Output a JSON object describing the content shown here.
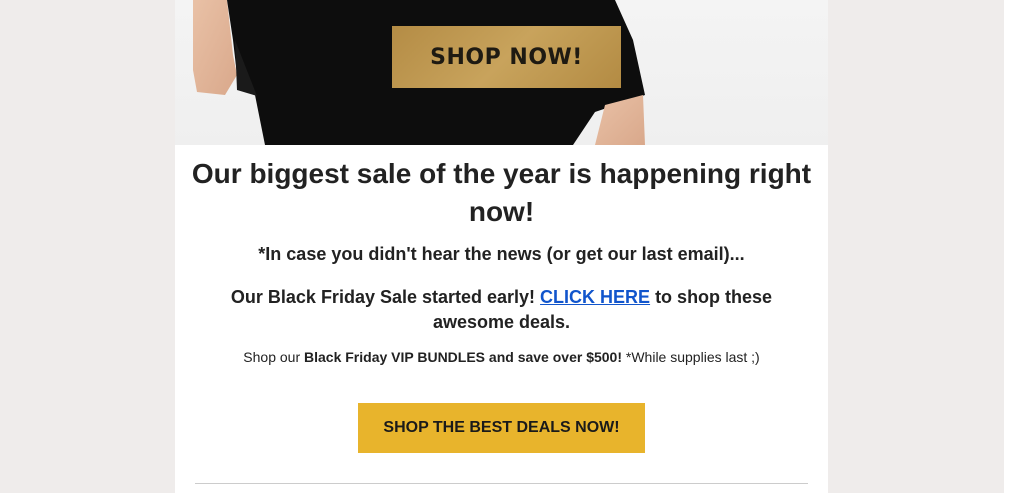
{
  "hero": {
    "shop_label": "SHOP NOW!"
  },
  "headline": {
    "text": "Our biggest sale of the year is happening right now!"
  },
  "news": {
    "text": "*In case you didn't hear the news (or get our last email)..."
  },
  "early": {
    "before": "Our Black Friday Sale started early! ",
    "link_label": "CLICK HERE",
    "after": " to shop these awesome deals."
  },
  "vip": {
    "prefix": "Shop our ",
    "bold": "Black Friday VIP BUNDLES and save over $500!",
    "suffix": " *While supplies last ;)"
  },
  "cta": {
    "label": "SHOP THE BEST DEALS NOW!"
  },
  "colors": {
    "page_bg": "#efeceb",
    "gold_button": "#c8a35c",
    "cta_button": "#e8b42c",
    "link": "#1155cc"
  }
}
